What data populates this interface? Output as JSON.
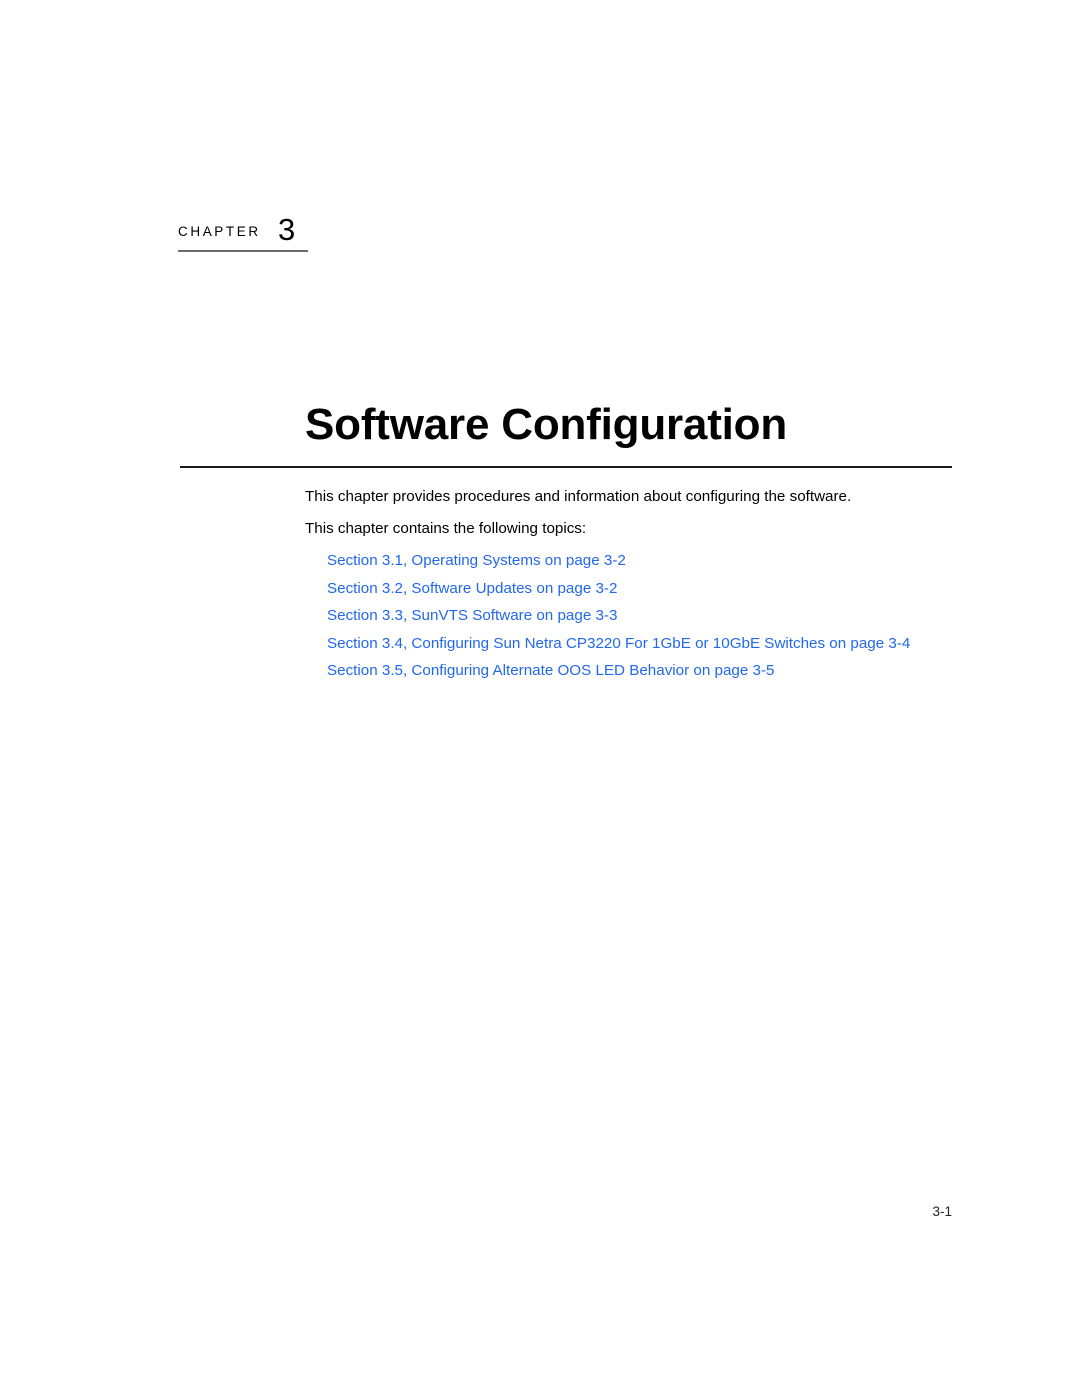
{
  "document": {
    "chapter_label": "CHAPTER",
    "chapter_number": "3",
    "title": "Software Configuration",
    "folio": "3-1"
  },
  "body": {
    "paragraph_1": "This chapter provides procedures and information about configuring the software.",
    "paragraph_2": "This chapter contains the following topics:"
  },
  "cross_references": [
    {
      "section": "Section 3.1,",
      "title": "Operating Systems",
      "page_ref": "on page 3-2",
      "full_text": "Section 3.1,  Operating Systems  on page 3-2"
    },
    {
      "section": "Section 3.2,",
      "title": "Software Updates",
      "page_ref": "on page 3-2",
      "full_text": "Section 3.2,  Software Updates  on page 3-2"
    },
    {
      "section": "Section 3.3,",
      "title": "SunVTS Software",
      "page_ref": "on page 3-3",
      "full_text": "Section 3.3,  SunVTS Software  on page 3-3"
    },
    {
      "section": "Section 3.4,",
      "title": "Configuring Sun Netra CP3220 For 1GbE or 10GbE Switches",
      "page_ref": "on page 3-4",
      "full_text": "Section 3.4,  Configuring Sun Netra CP3220 For 1GbE or 10GbE Switches  on page 3-4"
    },
    {
      "section": "Section 3.5,",
      "title": "Configuring Alternate OOS LED Behavior",
      "page_ref": "on page 3-5",
      "full_text": "Section 3.5,  Configuring Alternate OOS LED Behavior  on page 3-5"
    }
  ],
  "colors": {
    "link": "#2268ee",
    "text": "#000000",
    "chapter_rule": "#6b6b6b",
    "title_rule": "#1a1a1a",
    "page_background": "#ffffff"
  }
}
